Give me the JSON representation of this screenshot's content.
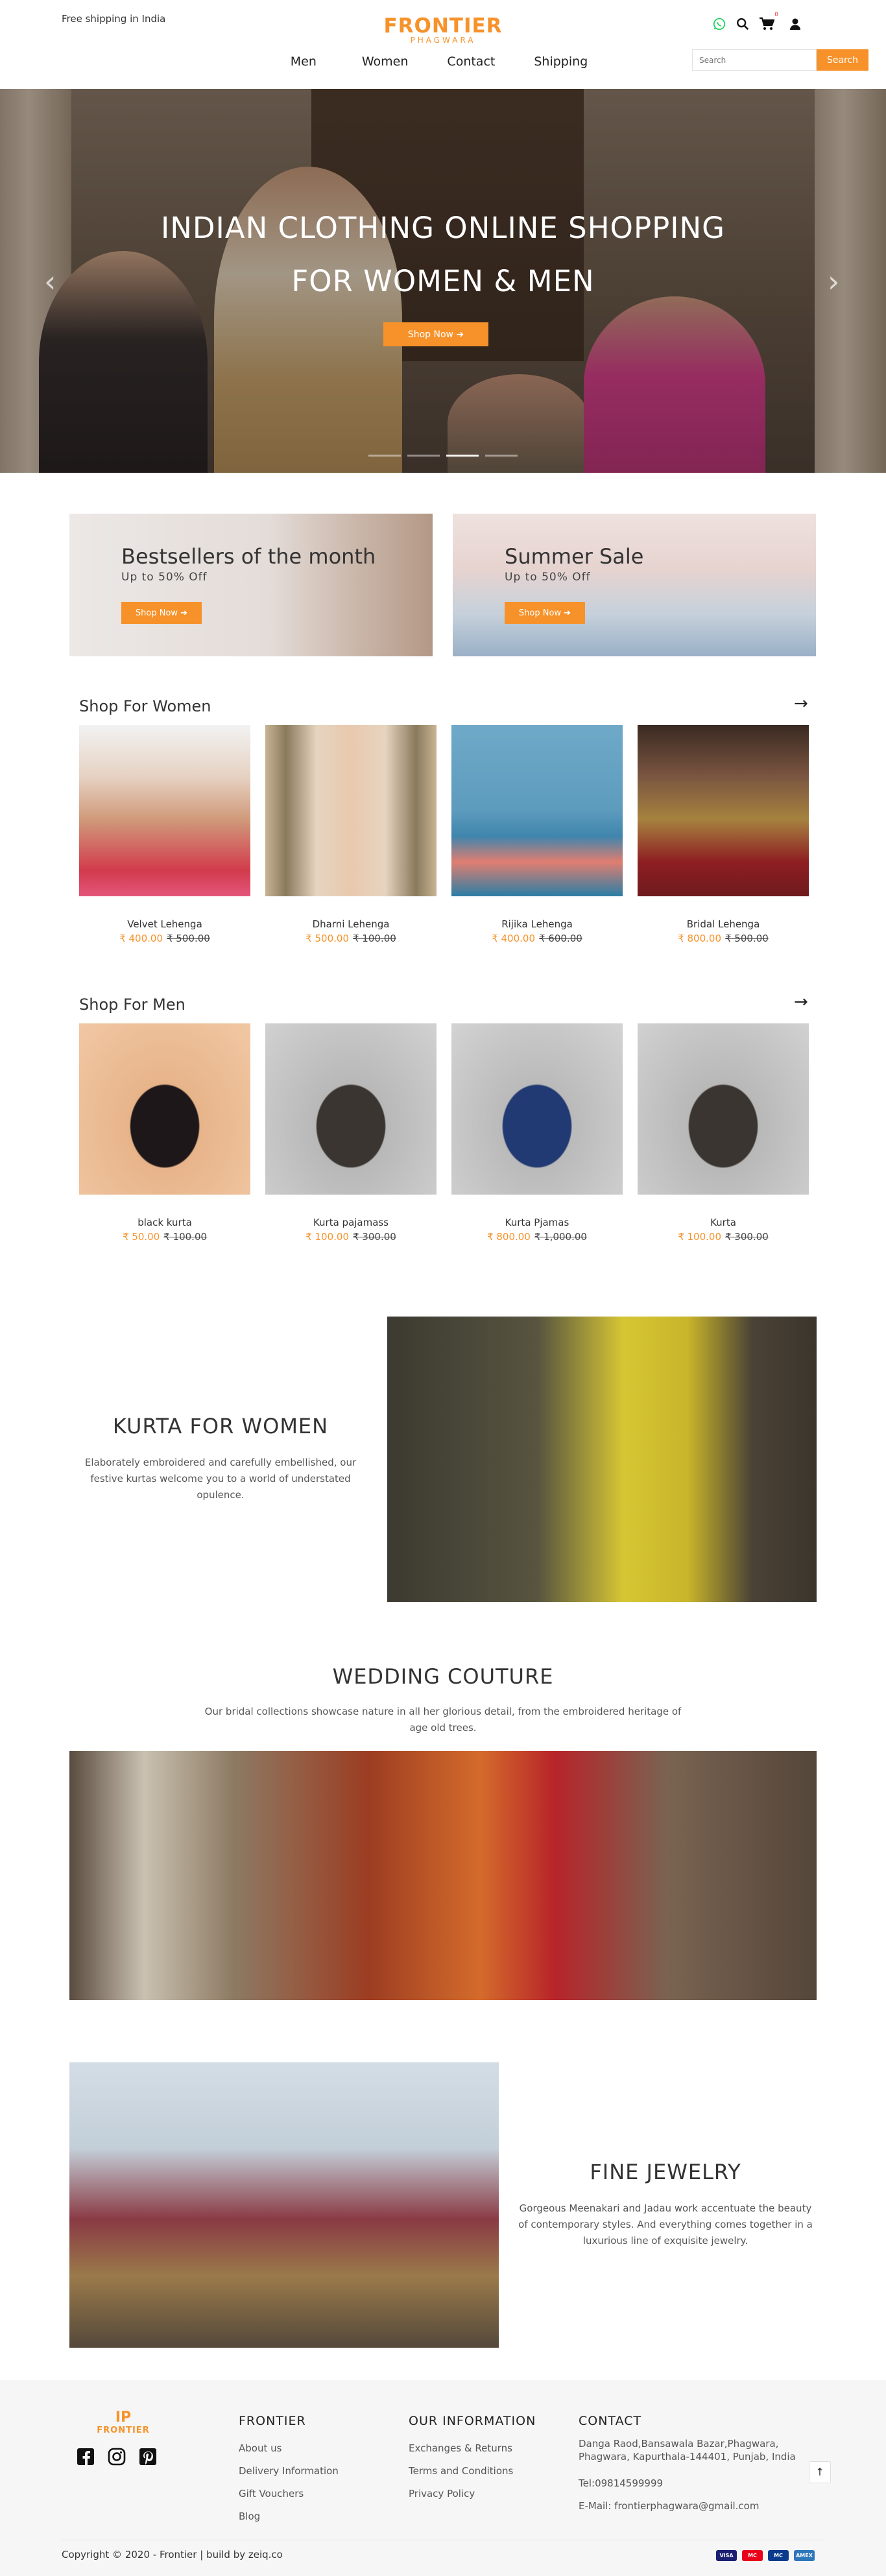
{
  "header": {
    "shipping_note": "Free shipping in India",
    "brand": "FRONTIER",
    "city": "PHAGWARA",
    "cart_count": "0",
    "nav": [
      {
        "label": "Men"
      },
      {
        "label": "Women"
      },
      {
        "label": "Contact"
      },
      {
        "label": "Shipping"
      }
    ],
    "search_placeholder": "Search",
    "search_button": "Search"
  },
  "hero": {
    "title_line1": "INDIAN CLOTHING ONLINE SHOPPING",
    "title_line2": "FOR WOMEN & MEN",
    "button": "Shop Now ➔",
    "prev": "‹",
    "next": "›",
    "slides_total": 4,
    "active_slide": 2
  },
  "promos": [
    {
      "title": "Bestsellers of the month",
      "subtitle": "Up to 50% Off",
      "button": "Shop Now ➔"
    },
    {
      "title": "Summer Sale",
      "subtitle": "Up to 50% Off",
      "button": "Shop Now ➔"
    }
  ],
  "women": {
    "title": "Shop For Women",
    "arrow": "→",
    "products": [
      {
        "name": "Velvet Lehenga",
        "price": "₹ 400.00",
        "was": "₹ 500.00"
      },
      {
        "name": "Dharni Lehenga",
        "price": "₹ 500.00",
        "was": "₹ 100.00"
      },
      {
        "name": "Rijika Lehenga",
        "price": "₹ 400.00",
        "was": "₹ 600.00"
      },
      {
        "name": "Bridal Lehenga",
        "price": "₹ 800.00",
        "was": "₹ 500.00"
      }
    ]
  },
  "men": {
    "title": "Shop For Men",
    "arrow": "→",
    "products": [
      {
        "name": "black kurta",
        "price": "₹ 50.00",
        "was": "₹ 100.00"
      },
      {
        "name": "Kurta pajamass",
        "price": "₹ 100.00",
        "was": "₹ 300.00"
      },
      {
        "name": "Kurta Pjamas",
        "price": "₹ 800.00",
        "was": "₹ 1,000.00"
      },
      {
        "name": "Kurta",
        "price": "₹ 100.00",
        "was": "₹ 300.00"
      }
    ]
  },
  "kurta": {
    "title": "KURTA FOR WOMEN",
    "text": "Elaborately embroidered and carefully embellished, our festive kurtas welcome you to a world of understated opulence."
  },
  "wedding": {
    "title": "WEDDING COUTURE",
    "text": "Our bridal collections showcase nature in all her glorious detail, from the embroidered heritage of age old trees."
  },
  "jewelry": {
    "title": "FINE JEWELRY",
    "text": "Gorgeous Meenakari and Jadau work accentuate the beauty of contemporary styles. And everything comes together in a luxurious line of exquisite jewelry."
  },
  "footer": {
    "logo_mark": "IP",
    "logo_word": "FRONTIER",
    "col1_title": "FRONTIER",
    "col1_links": [
      "About us",
      "Delivery Information",
      "Gift Vouchers",
      "Blog"
    ],
    "col2_title": "OUR INFORMATION",
    "col2_links": [
      "Exchanges & Returns",
      "Terms and Conditions",
      "Privacy Policy"
    ],
    "col3_title": "CONTACT",
    "address": "Danga Raod,Bansawala Bazar,Phagwara, Phagwara, Kapurthala-144401, Punjab, India",
    "phone": "Tel:09814599999",
    "email": "E-Mail: frontierphagwara@gmail.com",
    "copyright": "Copyright © 2020 - Frontier | build by zeiq.co",
    "back_top": "↑",
    "payments": [
      "VISA",
      "MC",
      "MC",
      "AMEX"
    ]
  },
  "colors": {
    "accent": "#f7922a",
    "footer_bg": "#f6f6f6"
  }
}
